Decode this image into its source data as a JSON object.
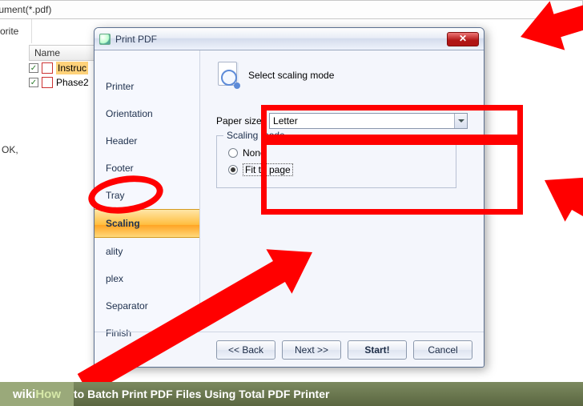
{
  "background": {
    "url_text": "Document(*.pdf)",
    "toolbar_label": "orite",
    "left_hint": "OK,",
    "list_header": "Name",
    "files": [
      {
        "name": "Instruc",
        "checked": true,
        "highlighted": true
      },
      {
        "name": "Phase2",
        "checked": true,
        "highlighted": false
      }
    ]
  },
  "dialog": {
    "title": "Print PDF",
    "close_glyph": "✕",
    "tabs": [
      "Printer",
      "Orientation",
      "Header",
      "Footer",
      "Tray",
      "Scaling",
      "ality",
      "plex",
      "Separator",
      "Finish"
    ],
    "selected_tab_index": 5,
    "heading": "Select scaling mode",
    "paper_size_label": "Paper size:",
    "paper_size_value": "Letter",
    "group_legend": "Scaling mode",
    "radio_none": "None",
    "radio_fit": "Fit to page",
    "selected_radio": "fit",
    "buttons": {
      "back": "<< Back",
      "next": "Next >>",
      "start": "Start!",
      "cancel": "Cancel"
    }
  },
  "caption": {
    "logo_left": "wiki",
    "logo_right": "How",
    "text": " to Batch Print PDF Files Using Total PDF Printer"
  }
}
